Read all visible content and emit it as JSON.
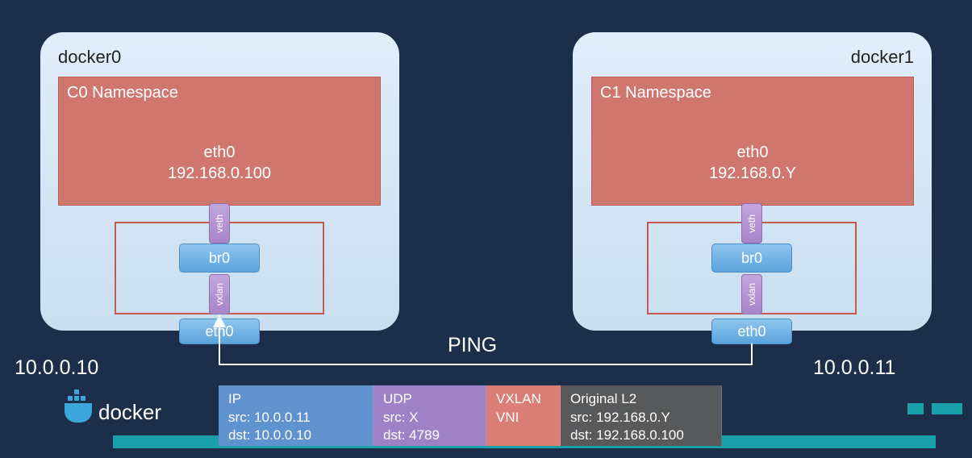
{
  "hosts": {
    "left": {
      "name": "docker0",
      "namespace": {
        "title": "C0 Namespace",
        "iface": "eth0",
        "ip": "192.168.0.100"
      },
      "veth": "veth",
      "bridge": "br0",
      "vxlan": "vxlan",
      "host_iface": "eth0",
      "host_ip": "10.0.0.10"
    },
    "right": {
      "name": "docker1",
      "namespace": {
        "title": "C1 Namespace",
        "iface": "eth0",
        "ip": "192.168.0.Y"
      },
      "veth": "veth",
      "bridge": "br0",
      "vxlan": "vxlan",
      "host_iface": "eth0",
      "host_ip": "10.0.0.11"
    }
  },
  "traffic_label": "PING",
  "packet": {
    "ip": {
      "title": "IP",
      "src": "src: 10.0.0.11",
      "dst": "dst: 10.0.0.10"
    },
    "udp": {
      "title": "UDP",
      "src": "src: X",
      "dst": "dst: 4789"
    },
    "vxlan": {
      "title": "VXLAN",
      "line2": "VNI"
    },
    "l2": {
      "title": "Original L2",
      "src": "src: 192.168.0.Y",
      "dst": "dst: 192.168.0.100"
    }
  },
  "logo_text": "docker"
}
